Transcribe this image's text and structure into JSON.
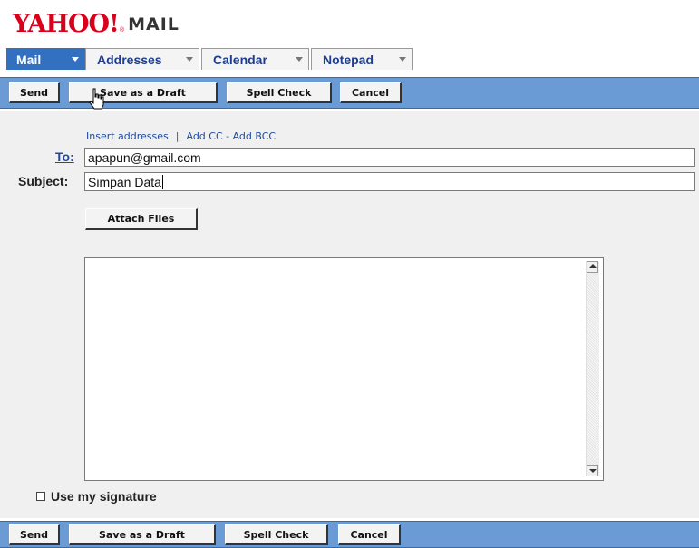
{
  "logo": {
    "brand": "YAHOO!",
    "product": "MAIL",
    "reg": "®"
  },
  "tabs": [
    {
      "label": "Mail",
      "active": true
    },
    {
      "label": "Addresses",
      "active": false
    },
    {
      "label": "Calendar",
      "active": false
    },
    {
      "label": "Notepad",
      "active": false
    }
  ],
  "toolbar": {
    "send": "Send",
    "save_draft": "Save as a Draft",
    "spell_check": "Spell Check",
    "cancel": "Cancel"
  },
  "compose": {
    "insert_addresses": "Insert addresses",
    "separator": "|",
    "add_cc_bcc": "Add CC - Add BCC",
    "to_label": "To:",
    "to_value": "apapun@gmail.com",
    "subject_label": "Subject:",
    "subject_value": "Simpan Data",
    "attach_files": "Attach Files",
    "body": "",
    "use_signature": "Use my signature",
    "use_signature_checked": false
  },
  "colors": {
    "toolbar_bg": "#6b9bd4",
    "active_tab": "#3370c0",
    "link": "#1f4aa0",
    "logo_red": "#d8001b"
  },
  "icons": [
    "hand-pointer-cursor-icon",
    "dropdown-arrow-icon",
    "scroll-up-icon",
    "scroll-down-icon"
  ]
}
